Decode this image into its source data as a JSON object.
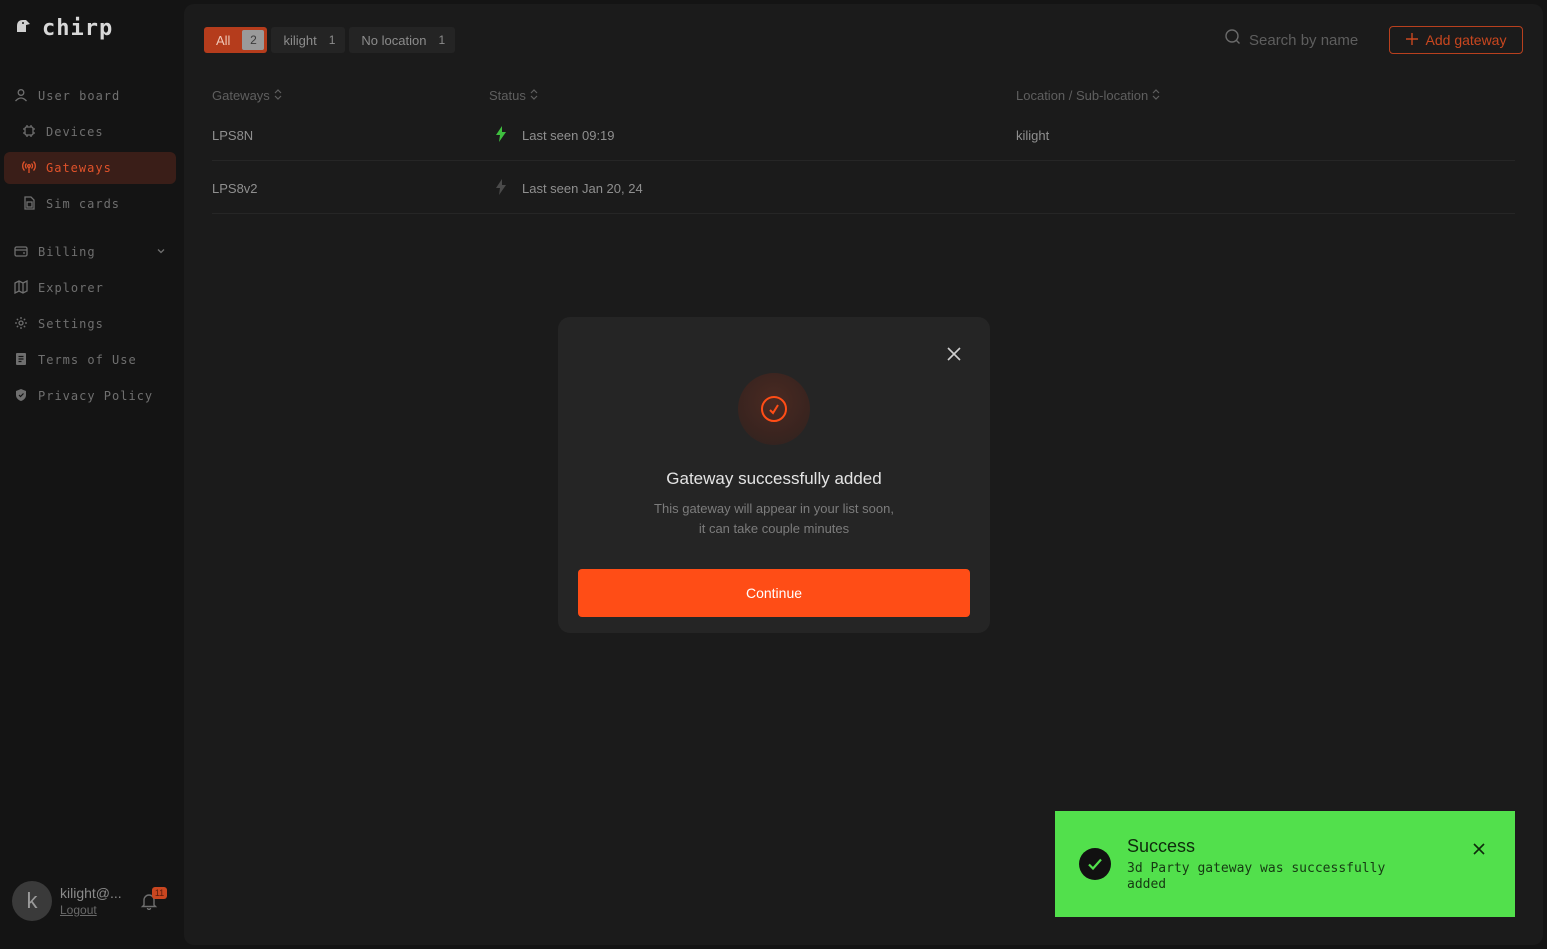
{
  "app": {
    "logo_text": "chirp"
  },
  "sidebar": {
    "items": [
      {
        "label": "User board",
        "icon": "user-icon"
      },
      {
        "label": "Devices",
        "icon": "chip-icon"
      },
      {
        "label": "Gateways",
        "icon": "antenna-icon",
        "active": true
      },
      {
        "label": "Sim cards",
        "icon": "sim-icon"
      },
      {
        "label": "Billing",
        "icon": "billing-icon"
      },
      {
        "label": "Explorer",
        "icon": "map-icon"
      },
      {
        "label": "Settings",
        "icon": "gear-icon"
      },
      {
        "label": "Terms of Use",
        "icon": "document-icon"
      },
      {
        "label": "Privacy Policy",
        "icon": "shield-icon"
      }
    ]
  },
  "user": {
    "initial": "k",
    "name": "kilight@...",
    "logout_label": "Logout",
    "notifications": "11"
  },
  "filters": [
    {
      "label": "All",
      "count": "2",
      "active": true
    },
    {
      "label": "kilight",
      "count": "1"
    },
    {
      "label": "No location",
      "count": "1"
    }
  ],
  "search": {
    "placeholder": "Search by name"
  },
  "add_button": {
    "label": "Add gateway"
  },
  "table": {
    "columns": [
      "Gateways",
      "Status",
      "Location / Sub-location"
    ],
    "rows": [
      {
        "name": "LPS8N",
        "status": "Last seen 09:19",
        "online": true,
        "location": "kilight"
      },
      {
        "name": "LPS8v2",
        "status": "Last seen Jan 20, 24",
        "online": false,
        "location": ""
      }
    ]
  },
  "modal": {
    "title": "Gateway successfully added",
    "body_line1": "This gateway will appear in your list soon,",
    "body_line2": "it can take couple minutes",
    "button": "Continue"
  },
  "toast": {
    "title": "Success",
    "message": "3d Party gateway was successfully added"
  },
  "colors": {
    "accent": "#ff4d16",
    "success": "#52e04c",
    "online": "#3fbf3f"
  }
}
